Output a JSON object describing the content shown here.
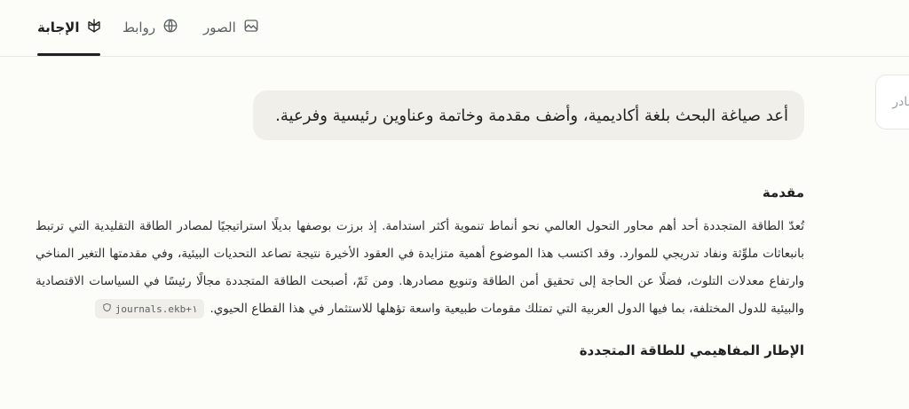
{
  "tabs": {
    "answer": "الإجابة",
    "links": "روابط",
    "images": "الصور"
  },
  "side_stub": {
    "label": "مادر"
  },
  "query": {
    "text": "أعد صياغة البحث بلغة أكاديمية، وأضف مقدمة وخاتمة وعناوين رئيسية وفرعية."
  },
  "answer": {
    "intro_heading": "مقدمة",
    "intro_paragraph": "تُعدّ الطاقة المتجددة أحد أهم محاور التحول العالمي نحو أنماط تنموية أكثر استدامة. إذ برزت بوصفها بديلًا استراتيجيًا لمصادر الطاقة التقليدية التي ترتبط بانبعاثات ملوِّثة ونفاد تدريجي للموارد. وقد اكتسب هذا الموضوع أهمية متزايدة في العقود الأخيرة نتيجة تصاعد التحديات البيئية، وفي مقدمتها التغير المناخي وارتفاع معدلات التلوث، فضلًا عن الحاجة إلى تحقيق أمن الطاقة وتنويع مصادرها. ومن ثَمّ، أصبحت الطاقة المتجددة مجالًا رئيسًا في السياسات الاقتصادية والبيئية للدول المختلفة، بما فيها الدول العربية التي تمتلك مقومات طبيعية واسعة تؤهلها للاستثمار في هذا القطاع الحيوي.",
    "citation": "journals.ekb+١",
    "section_heading": "الإطار المفاهيمي للطاقة المتجددة"
  }
}
